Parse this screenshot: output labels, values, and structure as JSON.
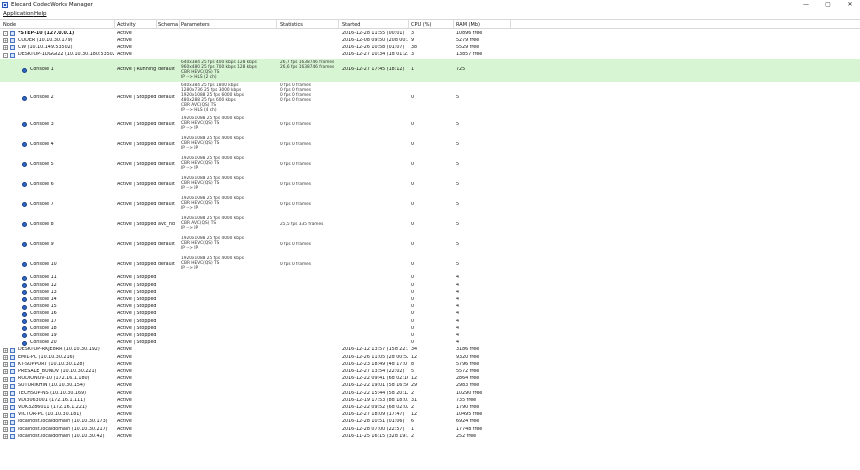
{
  "app": {
    "title": "Elecard CodecWorks Manager"
  },
  "window_controls": {
    "minimize": "—",
    "maximize": "▢",
    "close": "✕"
  },
  "menu": [
    "Application",
    "Help"
  ],
  "columns": [
    "Node",
    "Activity",
    "Schema",
    "Parameters",
    "Statistics",
    "Started",
    "CPU (%)",
    "RAM (Mb)"
  ],
  "rows": [
    {
      "kind": "server",
      "expander": "-",
      "node": "*STEP-10 (127.0.0.1)",
      "activity": "Active",
      "started": "2016-12-28 11:55 (00:01)",
      "cpu": "3",
      "ram": "10896 free",
      "bold": true
    },
    {
      "kind": "server",
      "expander": "+",
      "node": "CODER (10.10.30.179)",
      "activity": "Active",
      "started": "2016-12-08 09:50 (20d 00:...)",
      "cpu": "9",
      "ram": "5279 free"
    },
    {
      "kind": "server",
      "expander": "+",
      "node": "CW (10.10.149.53502)",
      "activity": "Active",
      "started": "2016-12-26 10:58 (01:07)",
      "cpu": "38",
      "ram": "5529 free"
    },
    {
      "kind": "server",
      "expander": "-",
      "node": "DESKTOP-1DGGI22 (10.10.30.180:53502)",
      "activity": "Active",
      "started": "2016-12-27 10:34 (1d 01:23)",
      "cpu": "3",
      "ram": "13857 free"
    },
    {
      "kind": "console",
      "node": "Console 1",
      "activity": "Active | Running",
      "schema": "default",
      "params": [
        "640x384 25 fps 400 kbps 128 kbps",
        "960x480 25 fps 700 kbps 128 kbps",
        "CBR HEVC(QS) TS",
        "IP --> HLS (2 ch)"
      ],
      "stats": [
        "",
        "26,7 fps 1638746 frames",
        "26,6 fps 1638746 frames"
      ],
      "started": "2016-12-27 17:45 (18:12)",
      "cpu": "1",
      "ram": "725",
      "highlight": true
    },
    {
      "kind": "console",
      "node": "Console 2",
      "activity": "Active | Stopped",
      "schema": "default",
      "params": [
        "640x384 25 fps 1800 kbps",
        "1280x736 25 fps 3000 kbps",
        "1920x1088 25 fps 6000 kbps",
        "480x288 25 fps 600 kbps",
        "CBR AVC(QS) TS",
        "IP --> HLS (4 ch)"
      ],
      "stats": [
        "",
        "0 fps 0 frames",
        "0 fps 0 frames",
        "0 fps 0 frames",
        "0 fps 0 frames"
      ],
      "started": "",
      "cpu": "0",
      "ram": "5"
    },
    {
      "kind": "console",
      "node": "Console 3",
      "activity": "Active | Stopped",
      "schema": "default",
      "params": [
        "1920x1088 25 fps 4000 kbps",
        "CBR HEVC(QS) TS",
        "IP --> IP"
      ],
      "stats": [
        "0 fps 0 frames"
      ],
      "started": "",
      "cpu": "0",
      "ram": "5"
    },
    {
      "kind": "console",
      "node": "Console 4",
      "activity": "Active | Stopped",
      "schema": "default",
      "params": [
        "1920x1088 25 fps 4000 kbps",
        "CBR HEVC(QS) TS",
        "IP --> IP"
      ],
      "stats": [
        "0 fps 0 frames"
      ],
      "started": "",
      "cpu": "0",
      "ram": "5"
    },
    {
      "kind": "console",
      "node": "Console 5",
      "activity": "Active | Stopped",
      "schema": "default",
      "params": [
        "1920x1088 25 fps 4000 kbps",
        "CBR HEVC(QS) TS",
        "IP --> IP"
      ],
      "stats": [
        "0 fps 0 frames"
      ],
      "started": "",
      "cpu": "0",
      "ram": "5"
    },
    {
      "kind": "console",
      "node": "Console 6",
      "activity": "Active | Stopped",
      "schema": "default",
      "params": [
        "1920x1088 25 fps 4000 kbps",
        "CBR HEVC(QS) TS",
        "IP --> IP"
      ],
      "stats": [
        "0 fps 0 frames"
      ],
      "started": "",
      "cpu": "0",
      "ram": "5"
    },
    {
      "kind": "console",
      "node": "Console 7",
      "activity": "Active | Stopped",
      "schema": "default",
      "params": [
        "1920x1088 25 fps 4000 kbps",
        "CBR HEVC(QS) TS",
        "IP --> IP"
      ],
      "stats": [
        "0 fps 0 frames"
      ],
      "started": "",
      "cpu": "0",
      "ram": "5"
    },
    {
      "kind": "console",
      "node": "Console 8",
      "activity": "Active | Stopped",
      "schema": "avc_hd",
      "params": [
        "1920x1088 25 fps 4000 kbps",
        "CBR AVC(QS) TS",
        "IP --> IP"
      ],
      "stats": [
        "25,5 fps 335 frames"
      ],
      "started": "",
      "cpu": "0",
      "ram": "5"
    },
    {
      "kind": "console",
      "node": "Console 9",
      "activity": "Active | Stopped",
      "schema": "default",
      "params": [
        "1920x1088 25 fps 4000 kbps",
        "CBR HEVC(QS) TS",
        "IP --> IP"
      ],
      "stats": [
        "0 fps 0 frames"
      ],
      "started": "",
      "cpu": "0",
      "ram": "5"
    },
    {
      "kind": "console",
      "node": "Console 10",
      "activity": "Active | Stopped",
      "schema": "default",
      "params": [
        "1920x1088 25 fps 4000 kbps",
        "CBR HEVC(QS) TS",
        "IP --> IP"
      ],
      "stats": [
        "0 fps 0 frames"
      ],
      "started": "",
      "cpu": "0",
      "ram": "5"
    },
    {
      "kind": "console",
      "node": "Console 11",
      "activity": "Active | Stopped",
      "schema": "",
      "params": [],
      "stats": [],
      "started": "",
      "cpu": "0",
      "ram": "4"
    },
    {
      "kind": "console",
      "node": "Console 12",
      "activity": "Active | Stopped",
      "schema": "",
      "params": [],
      "stats": [],
      "started": "",
      "cpu": "0",
      "ram": "4"
    },
    {
      "kind": "console",
      "node": "Console 13",
      "activity": "Active | Stopped",
      "schema": "",
      "params": [],
      "stats": [],
      "started": "",
      "cpu": "0",
      "ram": "4"
    },
    {
      "kind": "console",
      "node": "Console 14",
      "activity": "Active | Stopped",
      "schema": "",
      "params": [],
      "stats": [],
      "started": "",
      "cpu": "0",
      "ram": "4"
    },
    {
      "kind": "console",
      "node": "Console 15",
      "activity": "Active | Stopped",
      "schema": "",
      "params": [],
      "stats": [],
      "started": "",
      "cpu": "0",
      "ram": "4"
    },
    {
      "kind": "console",
      "node": "Console 16",
      "activity": "Active | Stopped",
      "schema": "",
      "params": [],
      "stats": [],
      "started": "",
      "cpu": "0",
      "ram": "4"
    },
    {
      "kind": "console",
      "node": "Console 17",
      "activity": "Active | Stopped",
      "schema": "",
      "params": [],
      "stats": [],
      "started": "",
      "cpu": "0",
      "ram": "4"
    },
    {
      "kind": "console",
      "node": "Console 18",
      "activity": "Active | Stopped",
      "schema": "",
      "params": [],
      "stats": [],
      "started": "",
      "cpu": "0",
      "ram": "4"
    },
    {
      "kind": "console",
      "node": "Console 19",
      "activity": "Active | Stopped",
      "schema": "",
      "params": [],
      "stats": [],
      "started": "",
      "cpu": "0",
      "ram": "4"
    },
    {
      "kind": "console",
      "node": "Console 20",
      "activity": "Active | Stopped",
      "schema": "",
      "params": [],
      "stats": [],
      "started": "",
      "cpu": "0",
      "ram": "4"
    },
    {
      "kind": "server",
      "expander": "+",
      "node": "DESKTOP-RKJE8RR (10.10.30.192)",
      "activity": "Active",
      "started": "2016-12-12 13:57 (15d 22:...)",
      "cpu": "34",
      "ram": "3186 free"
    },
    {
      "kind": "server",
      "expander": "+",
      "node": "EMIL-PC (10.10.30.216)",
      "activity": "Active",
      "started": "2016-12-26 11:05 (2d 00:52)",
      "cpu": "12",
      "ram": "9320 free"
    },
    {
      "kind": "server",
      "expander": "+",
      "node": "KT-SUPPORT (10.10.30.128)",
      "activity": "Active",
      "started": "2016-12-23 18:49 (4d 17:07)",
      "cpu": "8",
      "ram": "5796 free"
    },
    {
      "kind": "server",
      "expander": "+",
      "node": "PRESALE_BUNDV (10.10.30.221)",
      "activity": "Active",
      "started": "2016-12-27 13:54 (22:02)",
      "cpu": "5",
      "ram": "5572 free"
    },
    {
      "kind": "server",
      "expander": "+",
      "node": "RODIONOV-10 (172.16.1.180)",
      "activity": "Active",
      "started": "2016-12-22 09:41 (6d 02:16)",
      "cpu": "12",
      "ram": "2864 free"
    },
    {
      "kind": "server",
      "expander": "+",
      "node": "SUTURIKHIN (10.10.30.154)",
      "activity": "Active",
      "started": "2016-12-22 19:01 (5d 16:56)",
      "cpu": "29",
      "ram": "2983 free"
    },
    {
      "kind": "server",
      "expander": "+",
      "node": "TECHSUP-NS (10.10.30.169)",
      "activity": "Active",
      "started": "2016-12-22 15:44 (5d 20:12)",
      "cpu": "2",
      "ram": "10290 free"
    },
    {
      "kind": "server",
      "expander": "+",
      "node": "VDI3063001 (172.16.1.111)",
      "activity": "Active",
      "started": "2016-12-19 17:53 (8d 18:03)",
      "cpu": "31",
      "ram": "735 free"
    },
    {
      "kind": "server",
      "expander": "+",
      "node": "VDK3286011 (172.16.1.221)",
      "activity": "Active",
      "started": "2016-12-22 09:52 (6d 02:02)",
      "cpu": "2",
      "ram": "1790 free"
    },
    {
      "kind": "server",
      "expander": "+",
      "node": "VICTOR-PC (10.10.30.181)",
      "activity": "Active",
      "started": "2016-12-27 18:09 (17:47)",
      "cpu": "12",
      "ram": "10495 free"
    },
    {
      "kind": "server",
      "expander": "+",
      "node": "localhost.localdomain (10.10.30.173)",
      "activity": "Active",
      "started": "2016-12-28 10:51 (01:06)",
      "cpu": "6",
      "ram": "6924 free"
    },
    {
      "kind": "server",
      "expander": "+",
      "node": "localhost.localdomain (10.10.30.217)",
      "activity": "Active",
      "started": "2016-12-28 07:00 (22:57)",
      "cpu": "1",
      "ram": "17748 free"
    },
    {
      "kind": "server",
      "expander": "+",
      "node": "localhost.localdomain (10.10.30.42)",
      "activity": "Active",
      "started": "2016-11-25 16:15 (32d 19:...)",
      "cpu": "2",
      "ram": "252 free"
    }
  ]
}
